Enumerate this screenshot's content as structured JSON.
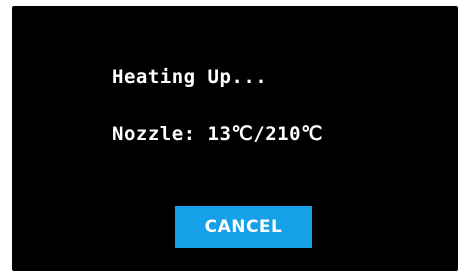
{
  "dialog": {
    "heading": "Heating Up...",
    "nozzle_label": "Nozzle:",
    "nozzle_current": "13",
    "nozzle_target": "210",
    "temp_unit": "℃",
    "cancel_label": "CANCEL"
  },
  "colors": {
    "background": "#000000",
    "text": "#ffffff",
    "button": "#15a0e8"
  }
}
